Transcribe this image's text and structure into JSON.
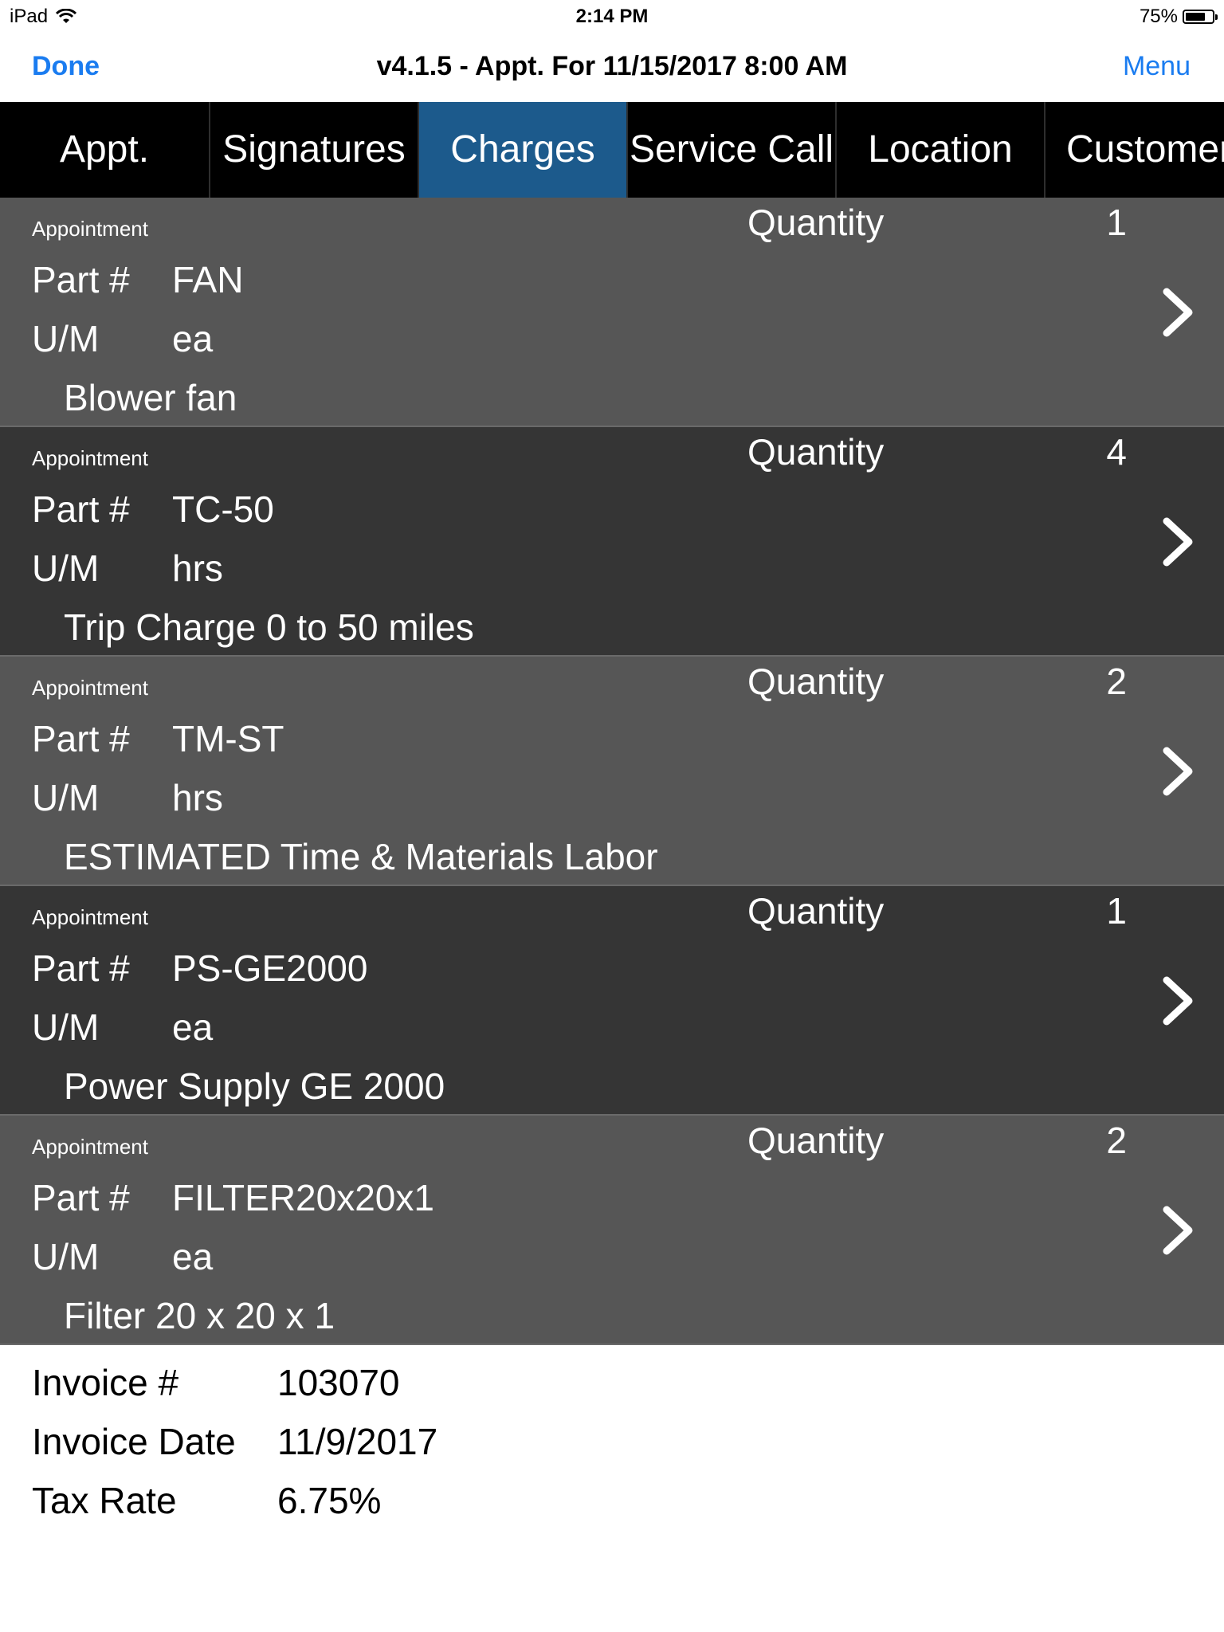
{
  "status_bar": {
    "device": "iPad",
    "time": "2:14 PM",
    "battery_percent": "75%",
    "battery_level": 0.75
  },
  "nav": {
    "done_label": "Done",
    "title": "v4.1.5 - Appt. For 11/15/2017 8:00 AM",
    "menu_label": "Menu"
  },
  "tabs": [
    {
      "label": "Appt."
    },
    {
      "label": "Signatures"
    },
    {
      "label": "Charges",
      "active": true
    },
    {
      "label": "Service Call"
    },
    {
      "label": "Location"
    },
    {
      "label": "Customer"
    }
  ],
  "charge_labels": {
    "quantity": "Quantity",
    "part": "Part #",
    "um": "U/M"
  },
  "charges": [
    {
      "source": "Appointment",
      "quantity": "1",
      "part": "FAN",
      "um": "ea",
      "description": "Blower fan"
    },
    {
      "source": "Appointment",
      "quantity": "4",
      "part": "TC-50",
      "um": "hrs",
      "description": "Trip Charge 0 to 50 miles"
    },
    {
      "source": "Appointment",
      "quantity": "2",
      "part": "TM-ST",
      "um": "hrs",
      "description": "ESTIMATED Time & Materials Labor"
    },
    {
      "source": "Appointment",
      "quantity": "1",
      "part": "PS-GE2000",
      "um": "ea",
      "description": "Power Supply GE 2000"
    },
    {
      "source": "Appointment",
      "quantity": "2",
      "part": "FILTER20x20x1",
      "um": "ea",
      "description": "Filter 20 x 20 x 1"
    }
  ],
  "invoice": {
    "number_label": "Invoice #",
    "number": "103070",
    "date_label": "Invoice Date",
    "date": "11/9/2017",
    "tax_label": "Tax Rate",
    "tax_rate": "6.75%"
  },
  "colors": {
    "accent_blue": "#1a7cf0",
    "active_tab": "#1c5a8c",
    "row_light": "#565656",
    "row_dark": "#353535"
  }
}
